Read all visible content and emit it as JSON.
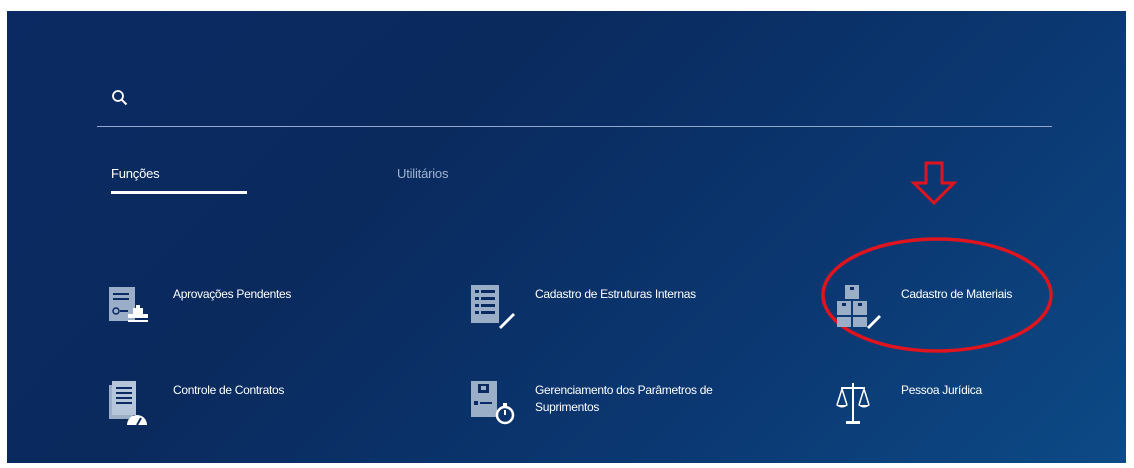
{
  "search": {
    "placeholder": "",
    "icon": "search-icon"
  },
  "tabs": [
    {
      "label": "Funções",
      "active": true
    },
    {
      "label": "Utilitários",
      "active": false
    }
  ],
  "tiles": [
    {
      "label": "Aprovações Pendentes",
      "icon": "approval-stamp-icon"
    },
    {
      "label": "Cadastro de Estruturas Internas",
      "icon": "structure-list-edit-icon"
    },
    {
      "label": "Cadastro de Materiais",
      "icon": "materials-boxes-edit-icon"
    },
    {
      "label": "Controle de Contratos",
      "icon": "contract-gauge-icon"
    },
    {
      "label": "Gerenciamento dos Parâmetros de Suprimentos",
      "icon": "supply-parameters-timer-icon"
    },
    {
      "label": "Pessoa Jurídica",
      "icon": "scales-icon"
    }
  ],
  "colors": {
    "background": "#0b2a63",
    "text": "#ffffff",
    "annotation": "#e0141e",
    "icon": "#9aaec8"
  }
}
